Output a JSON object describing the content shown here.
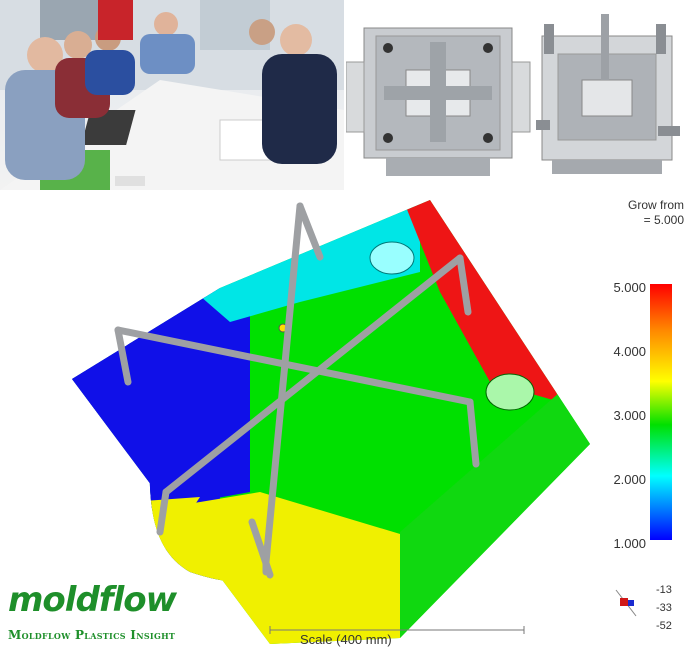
{
  "plot": {
    "grow_from_label": "Grow from",
    "grow_from_value": "= 5.000"
  },
  "legend": {
    "ticks": [
      "5.000",
      "4.000",
      "3.000",
      "2.000",
      "1.000"
    ],
    "colors": [
      "#ff0000",
      "#ffff00",
      "#00e000",
      "#00ffff",
      "#0000ff"
    ]
  },
  "scale": {
    "label": "Scale (400 mm)"
  },
  "axis_triad": {
    "values": [
      "-13",
      "-33",
      "-52"
    ]
  },
  "logo": {
    "word": "moldflow",
    "subtitle": "Moldflow Plastics Insight"
  }
}
